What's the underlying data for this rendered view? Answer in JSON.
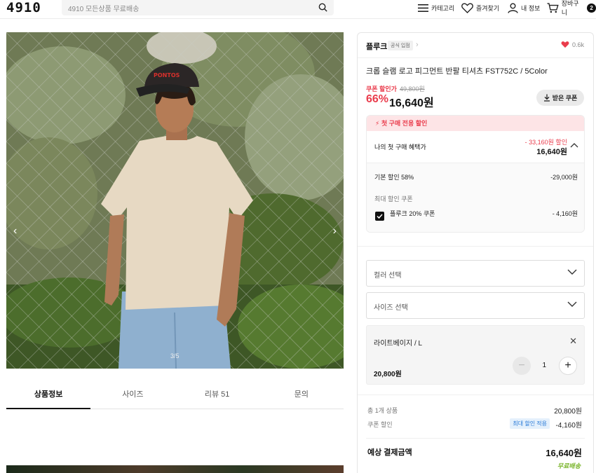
{
  "header": {
    "logo": "4910",
    "search_placeholder": "4910 모든상품 무료배송",
    "nav": {
      "category": "카테고리",
      "favorites": "즐겨찾기",
      "my_info": "내 정보",
      "cart": "장바구니",
      "cart_count": "2"
    }
  },
  "gallery": {
    "counter": "3/5"
  },
  "tabs": [
    {
      "label": "상품정보",
      "active": true
    },
    {
      "label": "사이즈",
      "active": false
    },
    {
      "label": "리뷰 51",
      "active": false
    },
    {
      "label": "문의",
      "active": false
    }
  ],
  "product": {
    "brand": "플루크",
    "official_badge": "공식 입점",
    "likes": "0.6k",
    "title": "크롭 슬램 로고 피그먼트 반팔 티셔츠 FST752C / 5Color",
    "coupon_price_label": "쿠폰 할인가",
    "original_price": "49,800원",
    "discount_percent": "66%",
    "price": "16,640원",
    "coupon_button": "받은 쿠폰"
  },
  "first_purchase": {
    "header": "첫 구매 전용 할인",
    "label": "나의 첫 구매 혜택가",
    "discount": "- 33,160원 할인",
    "total": "16,640원",
    "base_label": "기본 할인 58%",
    "base_value": "-29,000원",
    "max_coupon_label": "최대 할인 쿠폰",
    "coupon_name": "플루크 20% 쿠폰",
    "coupon_value": "- 4,160원"
  },
  "options": {
    "color_placeholder": "컬러 선택",
    "size_placeholder": "사이즈 선택",
    "selected_name": "라이트베이지 / L",
    "selected_price": "20,800원",
    "quantity": "1",
    "close": "✕",
    "minus": "−",
    "plus": "+"
  },
  "summary": {
    "total_items_label": "총 1개 상품",
    "total_items_value": "20,800원",
    "coupon_label": "쿠폰 할인",
    "coupon_badge": "최대 할인 적용",
    "coupon_value": "-4,160원",
    "payment_label": "예상 결제금액",
    "payment_value": "16,640원",
    "shipping": "무료배송"
  },
  "colors": {
    "accent_red": "#ea3c4c",
    "free_shipping_green": "#7cb62f",
    "badge_blue": "#2b7bd8"
  }
}
